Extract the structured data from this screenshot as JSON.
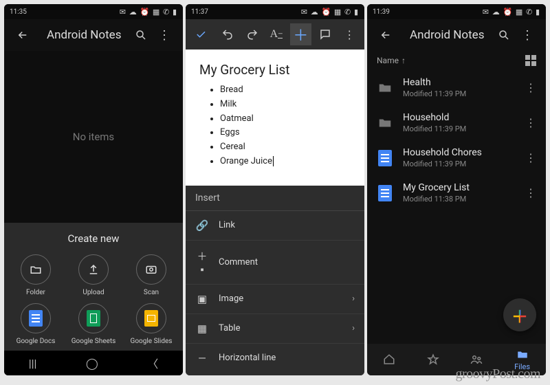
{
  "screen1": {
    "time": "11:35",
    "title": "Android Notes",
    "no_items": "No items",
    "sheet_title": "Create new",
    "actions": [
      {
        "label": "Folder"
      },
      {
        "label": "Upload"
      },
      {
        "label": "Scan"
      },
      {
        "label": "Google Docs"
      },
      {
        "label": "Google Sheets"
      },
      {
        "label": "Google Slides"
      }
    ]
  },
  "screen2": {
    "time": "11:37",
    "doc_title": "My Grocery List",
    "bullets": [
      "Bread",
      "Milk",
      "Oatmeal",
      "Eggs",
      "Cereal",
      "Orange Juice"
    ],
    "insert_header": "Insert",
    "insert_items": [
      {
        "label": "Link",
        "chevron": false
      },
      {
        "label": "Comment",
        "chevron": false
      },
      {
        "label": "Image",
        "chevron": true
      },
      {
        "label": "Table",
        "chevron": true
      },
      {
        "label": "Horizontal line",
        "chevron": false
      }
    ]
  },
  "screen3": {
    "time": "11:39",
    "title": "Android Notes",
    "sort_label": "Name",
    "files": [
      {
        "name": "Health",
        "modified": "Modified 11:39 PM",
        "type": "folder"
      },
      {
        "name": "Household",
        "modified": "Modified 11:39 PM",
        "type": "folder"
      },
      {
        "name": "Household Chores",
        "modified": "Modified 11:39 PM",
        "type": "doc"
      },
      {
        "name": "My Grocery List",
        "modified": "Modified 11:38 PM",
        "type": "doc"
      }
    ],
    "tabs": [
      "Home",
      "Starred",
      "Shared",
      "Files"
    ],
    "tab_files_label": "Files"
  },
  "watermark": "groovyPost.com"
}
